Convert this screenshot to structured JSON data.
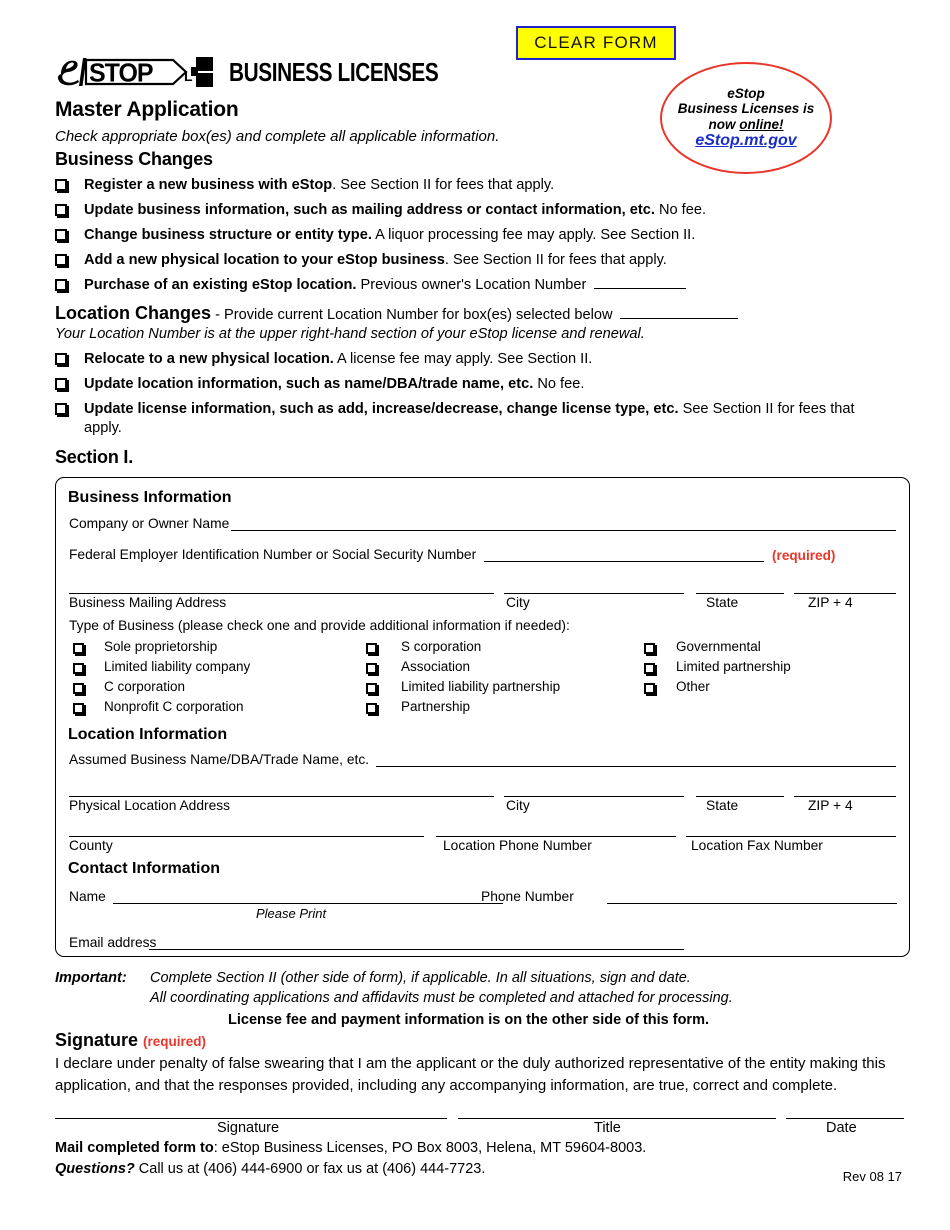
{
  "header": {
    "clear_form_label": "CLEAR FORM",
    "logo_e": "e",
    "logo_stop": "STOP",
    "logo_text": "BUSINESS LICENSES",
    "title": "Master Application",
    "subtitle": "Check appropriate box(es) and complete all applicable information."
  },
  "stamp": {
    "line1": "eStop",
    "line2": "Business Licenses is",
    "line3_a": "now ",
    "line3_b": "online!",
    "link": "eStop.mt.gov"
  },
  "business_changes": {
    "heading": "Business Changes",
    "items": [
      {
        "bold": "Register a new business with eStop",
        "rest": ". See Section II for fees that apply."
      },
      {
        "bold": "Update business information, such as mailing address or contact information, etc.",
        "rest": " No fee."
      },
      {
        "bold": "Change business structure or entity type.",
        "rest": " A liquor processing fee may apply. See Section II."
      },
      {
        "bold": "Add a new physical location to your eStop business",
        "rest": ". See Section II for fees that apply."
      },
      {
        "bold": "Purchase of an existing eStop location.",
        "rest": " Previous owner's Location Number"
      }
    ]
  },
  "location_changes": {
    "heading": "Location Changes",
    "heading_rest": " - Provide current Location Number for box(es) selected below",
    "note": "Your Location Number is at the upper right-hand section of your eStop license and renewal.",
    "items": [
      {
        "bold": "Relocate to a new physical location.",
        "rest": " A license fee may apply. See Section II."
      },
      {
        "bold": "Update location information, such as name/DBA/trade name, etc.",
        "rest": " No fee."
      },
      {
        "bold": "Update license information, such as add, increase/decrease, change license type, etc.",
        "rest": " See Section II for fees that apply."
      }
    ]
  },
  "section_one": {
    "label": "Section I.",
    "business_information": {
      "heading": "Business Information",
      "company_label": "Company or Owner Name",
      "fein_label": "Federal Employer Identification Number or Social Security Number",
      "required_tag": "(required)",
      "mailing_label": "Business Mailing Address",
      "city_label": "City",
      "state_label": "State",
      "zip_label": "ZIP + 4",
      "type_label": "Type of Business (please check one and provide additional information if needed):",
      "types_col1": [
        "Sole proprietorship",
        "Limited liability company",
        "C corporation",
        "Nonprofit C corporation"
      ],
      "types_col2": [
        "S corporation",
        "Association",
        "Limited liability partnership",
        "Partnership"
      ],
      "types_col3": [
        "Governmental",
        "Limited partnership",
        "Other"
      ]
    },
    "location_information": {
      "heading": "Location Information",
      "dba_label": "Assumed Business Name/DBA/Trade Name, etc.",
      "physical_label": "Physical Location Address",
      "city_label": "City",
      "state_label": "State",
      "zip_label": "ZIP + 4",
      "county_label": "County",
      "phone_label": "Location Phone Number",
      "fax_label": "Location Fax Number"
    },
    "contact_information": {
      "heading": "Contact Information",
      "name_label": "Name",
      "please_print": "Please Print",
      "phone_label": "Phone Number",
      "email_label": "Email address"
    }
  },
  "footer": {
    "important_label": "Important:",
    "important_line1": "Complete Section II (other side of form), if applicable. In all situations, sign and date.",
    "important_line2": "All coordinating applications and affidavits must be completed and attached for processing.",
    "license_fee_note": "License fee and payment information is on the other side of this form.",
    "signature_heading": "Signature",
    "signature_required": "(required)",
    "declaration": "I declare under penalty of false swearing that I am the applicant or the duly authorized representative of the entity making this application, and that the responses provided, including any accompanying information, are true, correct and complete.",
    "signature_label": "Signature",
    "title_label": "Title",
    "date_label": "Date",
    "mail_bold": "Mail completed form to",
    "mail_rest": ": eStop Business Licenses, PO Box 8003, Helena, MT 59604-8003.",
    "questions_bold": "Questions?",
    "questions_rest": " Call us at (406) 444-6900 or fax us at (406) 444-7723.",
    "rev": "Rev 08 17"
  },
  "colors": {
    "clear_form_bg": "#ffff00",
    "clear_form_border": "#2222cc",
    "stamp_red": "#e8362a",
    "link_blue": "#1a2ec4",
    "required_red": "#e8362a"
  }
}
